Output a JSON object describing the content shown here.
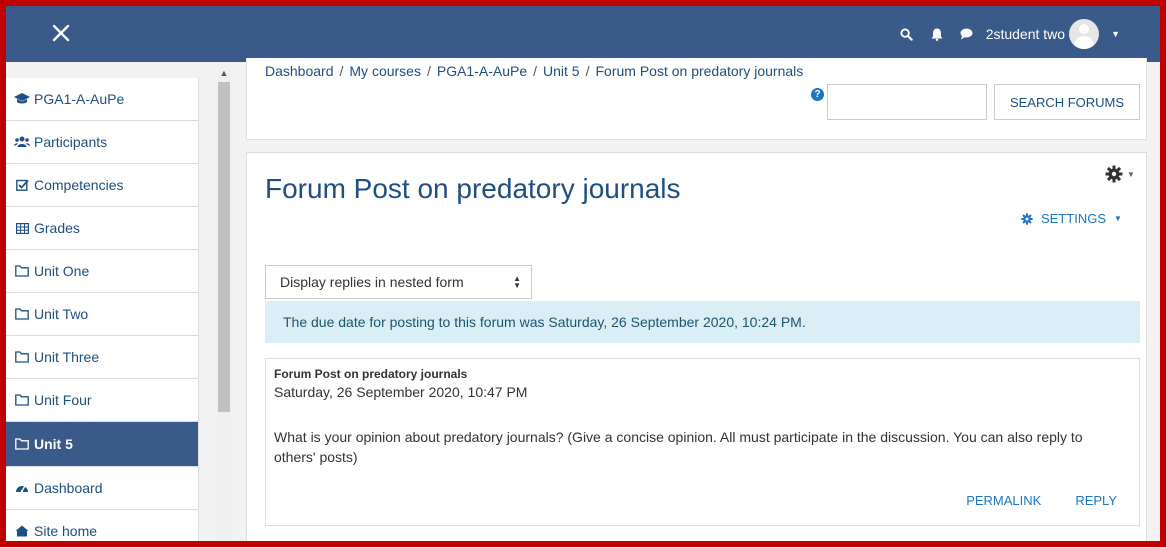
{
  "navbar": {
    "user_name": "2student two",
    "accent_color": "#3a5a8a"
  },
  "sidebar": {
    "items": [
      {
        "label": "PGA1-A-AuPe",
        "icon": "graduation-cap-icon"
      },
      {
        "label": "Participants",
        "icon": "users-icon"
      },
      {
        "label": "Competencies",
        "icon": "checkbox-icon"
      },
      {
        "label": "Grades",
        "icon": "table-icon"
      },
      {
        "label": "Unit One",
        "icon": "folder-icon"
      },
      {
        "label": "Unit Two",
        "icon": "folder-icon"
      },
      {
        "label": "Unit Three",
        "icon": "folder-icon"
      },
      {
        "label": "Unit Four",
        "icon": "folder-icon"
      },
      {
        "label": "Unit 5",
        "icon": "folder-icon",
        "active": true
      },
      {
        "label": "Dashboard",
        "icon": "dashboard-icon"
      },
      {
        "label": "Site home",
        "icon": "home-icon"
      }
    ]
  },
  "breadcrumb": {
    "items": [
      "Dashboard",
      "My courses",
      "PGA1-A-AuPe",
      "Unit 5",
      "Forum Post on predatory journals"
    ]
  },
  "search": {
    "placeholder": "",
    "button_label": "SEARCH FORUMS"
  },
  "forum": {
    "title": "Forum Post on predatory journals",
    "settings_label": "SETTINGS",
    "display_mode": "Display replies in nested form",
    "notice": "The due date for posting to this forum was Saturday, 26 September 2020, 10:24 PM."
  },
  "post": {
    "subject": "Forum Post on predatory journals",
    "date": "Saturday, 26 September 2020, 10:47 PM",
    "body": "What is your opinion about predatory journals?  (Give a concise opinion. All must participate in the discussion. You can also reply to others' posts)",
    "permalink_label": "PERMALINK",
    "reply_label": "REPLY"
  }
}
